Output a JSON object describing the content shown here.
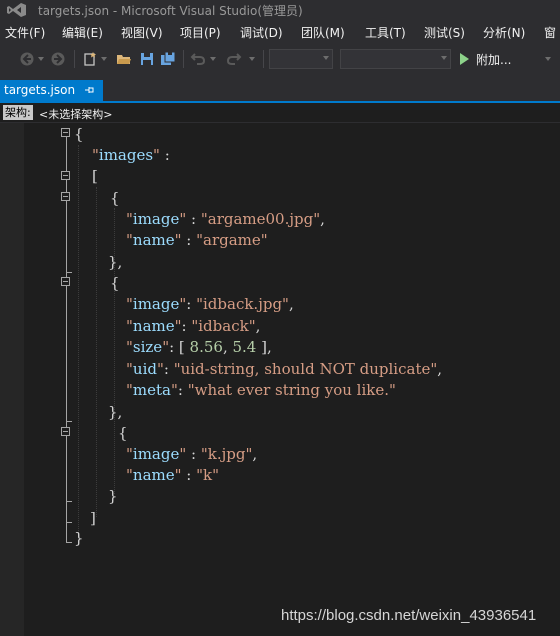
{
  "window": {
    "title": "targets.json - Microsoft Visual Studio(管理员)"
  },
  "menu": [
    "文件(F)",
    "编辑(E)",
    "视图(V)",
    "项目(P)",
    "调试(D)",
    "团队(M)",
    "工具(T)",
    "测试(S)",
    "分析(N)",
    "窗"
  ],
  "toolbar": {
    "icons": [
      "back-icon",
      "forward-icon",
      "new-project-icon",
      "open-folder-icon",
      "save-icon",
      "save-all-icon",
      "undo-icon",
      "redo-icon"
    ],
    "config_value": "",
    "platform_value": "",
    "run_label": "附加..."
  },
  "tab": {
    "title": "targets.json"
  },
  "navbar": {
    "label": "架构:",
    "schema": "<未选择架构>"
  },
  "code": [
    [
      [
        "p",
        "{"
      ]
    ],
    [
      [
        "s",
        "\""
      ],
      [
        "k",
        "images"
      ],
      [
        "s",
        "\""
      ],
      [
        "p",
        " :"
      ]
    ],
    [
      [
        "p",
        "["
      ]
    ],
    [
      [
        "p",
        "{"
      ]
    ],
    [
      [
        "s",
        "\""
      ],
      [
        "k",
        "image"
      ],
      [
        "s",
        "\""
      ],
      [
        "p",
        " : "
      ],
      [
        "s",
        "\"argame00.jpg\""
      ],
      [
        "p",
        ","
      ]
    ],
    [
      [
        "s",
        "\""
      ],
      [
        "k",
        "name"
      ],
      [
        "s",
        "\""
      ],
      [
        "p",
        " : "
      ],
      [
        "s",
        "\"argame\""
      ]
    ],
    [
      [
        "p",
        "},"
      ]
    ],
    [
      [
        "p",
        "{"
      ]
    ],
    [
      [
        "s",
        "\""
      ],
      [
        "k",
        "image"
      ],
      [
        "s",
        "\""
      ],
      [
        "p",
        ": "
      ],
      [
        "s",
        "\"idback.jpg\""
      ],
      [
        "p",
        ","
      ]
    ],
    [
      [
        "s",
        "\""
      ],
      [
        "k",
        "name"
      ],
      [
        "s",
        "\""
      ],
      [
        "p",
        ": "
      ],
      [
        "s",
        "\"idback\""
      ],
      [
        "p",
        ","
      ]
    ],
    [
      [
        "s",
        "\""
      ],
      [
        "k",
        "size"
      ],
      [
        "s",
        "\""
      ],
      [
        "p",
        ": [ "
      ],
      [
        "n",
        "8.56"
      ],
      [
        "p",
        ", "
      ],
      [
        "n",
        "5.4"
      ],
      [
        "p",
        " ],"
      ]
    ],
    [
      [
        "s",
        "\""
      ],
      [
        "k",
        "uid"
      ],
      [
        "s",
        "\""
      ],
      [
        "p",
        ": "
      ],
      [
        "s",
        "\"uid-string, should NOT duplicate\""
      ],
      [
        "p",
        ","
      ]
    ],
    [
      [
        "s",
        "\""
      ],
      [
        "k",
        "meta"
      ],
      [
        "s",
        "\""
      ],
      [
        "p",
        ": "
      ],
      [
        "s",
        "\"what ever string you like.\""
      ]
    ],
    [
      [
        "p",
        "},"
      ]
    ],
    [
      [
        "p",
        "{"
      ]
    ],
    [
      [
        "s",
        "\""
      ],
      [
        "k",
        "image"
      ],
      [
        "s",
        "\""
      ],
      [
        "p",
        " : "
      ],
      [
        "s",
        "\"k.jpg\""
      ],
      [
        "p",
        ","
      ]
    ],
    [
      [
        "s",
        "\""
      ],
      [
        "k",
        "name"
      ],
      [
        "s",
        "\""
      ],
      [
        "p",
        " : "
      ],
      [
        "s",
        "\"k\""
      ]
    ],
    [
      [
        "p",
        "}"
      ]
    ],
    [
      [
        "p",
        "]"
      ]
    ],
    [
      [
        "p",
        "}"
      ]
    ]
  ],
  "watermark": "https://blog.csdn.net/weixin_43936541"
}
